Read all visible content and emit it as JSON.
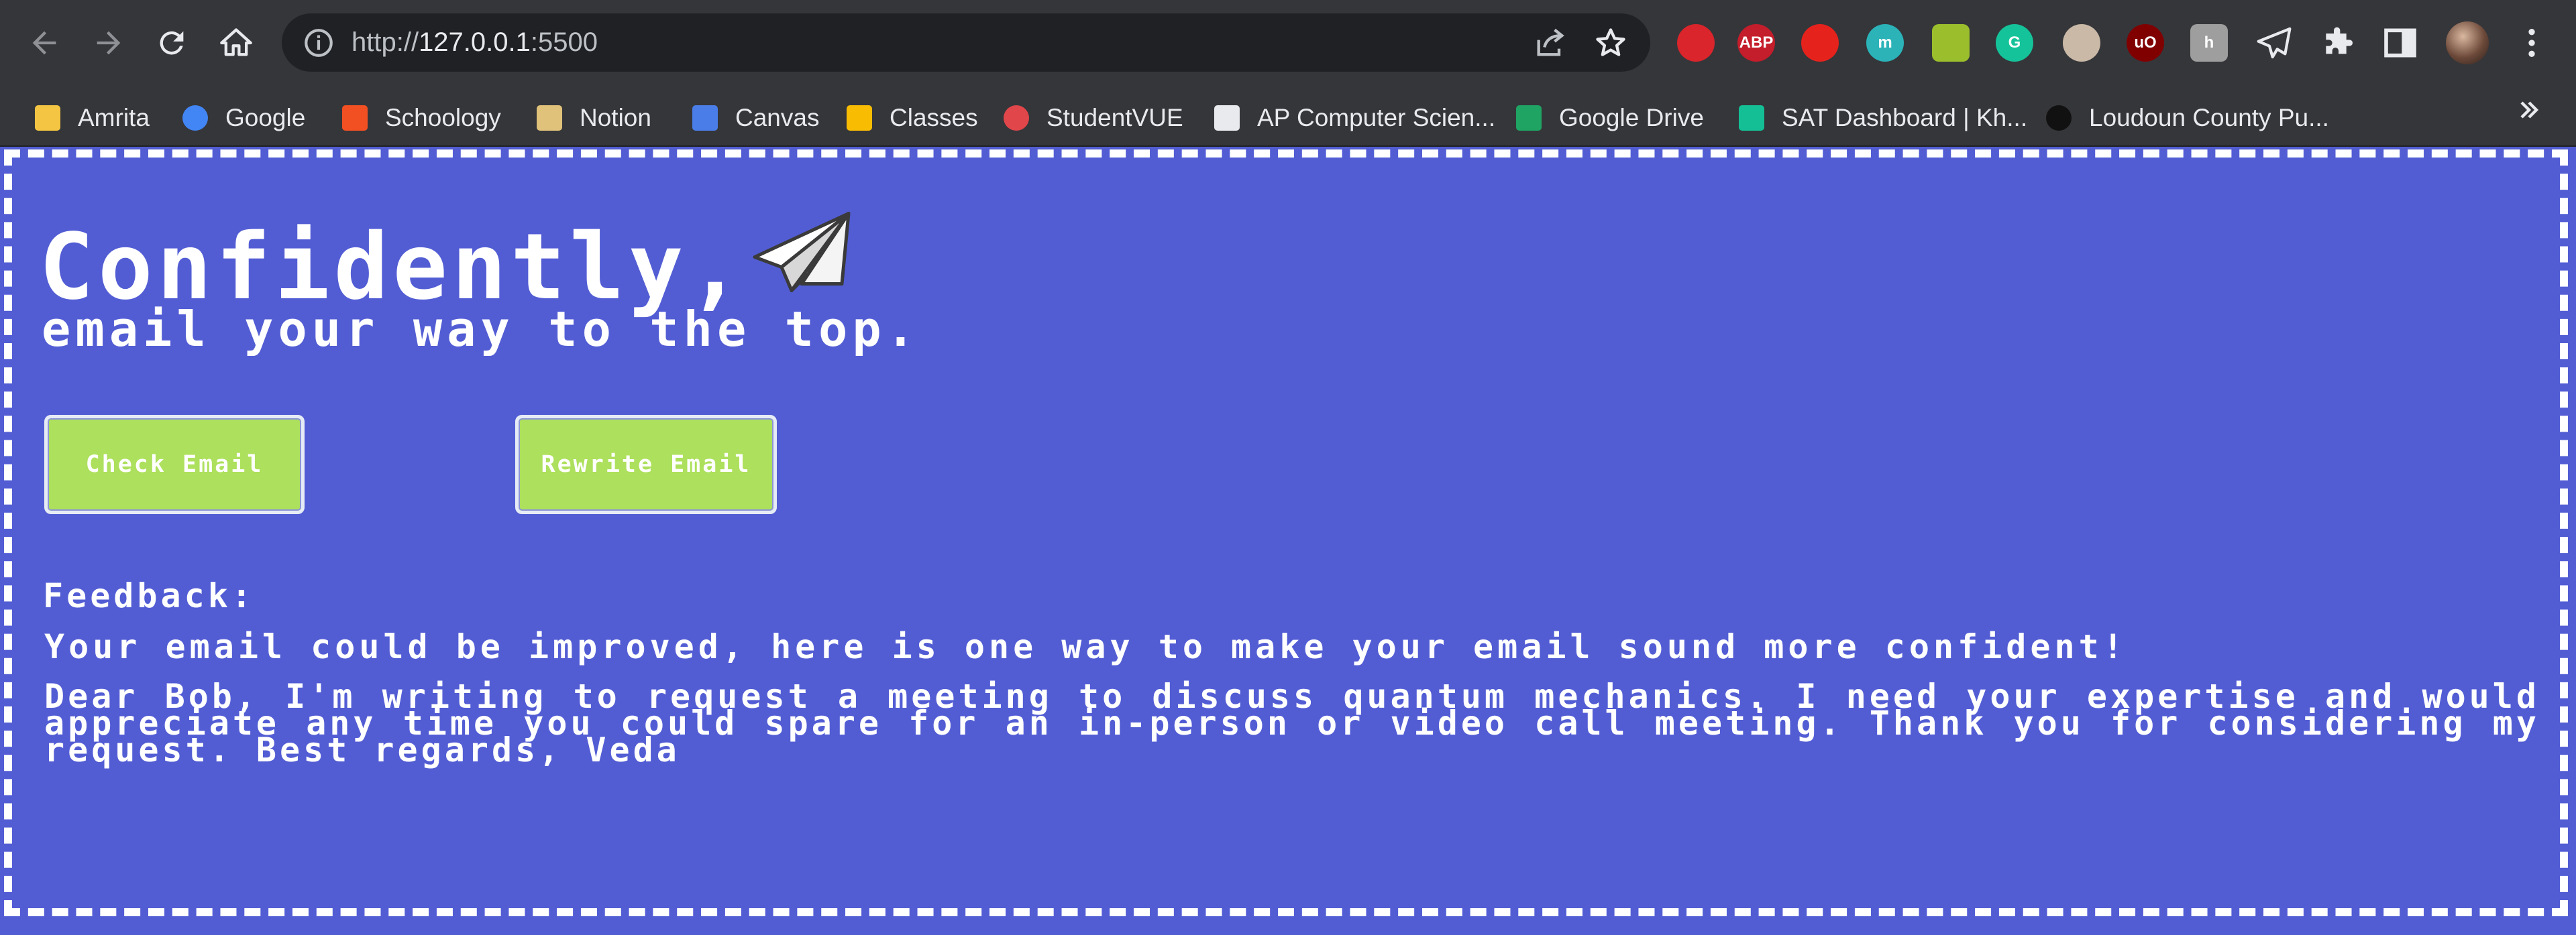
{
  "browser": {
    "url_scheme": "http://",
    "url_host": "127.0.0.1",
    "url_port": ":5500",
    "extensions": [
      {
        "name": "adblock-extension",
        "label": "",
        "color": "#d9252b"
      },
      {
        "name": "abp-extension",
        "label": "ABP",
        "color": "#c41d2b"
      },
      {
        "name": "video-speed-extension",
        "label": "",
        "color": "#e6221d"
      },
      {
        "name": "m-extension",
        "label": "m",
        "color": "#2bb3b8"
      },
      {
        "name": "earth-extension",
        "label": "",
        "color": "#9bbf2c"
      },
      {
        "name": "grammarly-extension",
        "label": "G",
        "color": "#15c39a"
      },
      {
        "name": "glasses-extension",
        "label": "",
        "color": "#c9b9a6"
      },
      {
        "name": "ublock-extension",
        "label": "uO",
        "color": "#800000"
      },
      {
        "name": "h-extension",
        "label": "h",
        "color": "#9e9e9e"
      }
    ]
  },
  "bookmarks": [
    {
      "label": "Amrita",
      "icon": "folder-icon",
      "color": "#f4c542"
    },
    {
      "label": "Google",
      "icon": "google-icon",
      "color": "#4285f4"
    },
    {
      "label": "Schoology",
      "icon": "schoology-icon",
      "color": "#f25022"
    },
    {
      "label": "Notion",
      "icon": "notion-icon",
      "color": "#e0c27a"
    },
    {
      "label": "Canvas",
      "icon": "canvas-icon",
      "color": "#4a7de8"
    },
    {
      "label": "Classes",
      "icon": "classroom-icon",
      "color": "#f8bc03"
    },
    {
      "label": "StudentVUE",
      "icon": "studentvue-icon",
      "color": "#e1464a"
    },
    {
      "label": "AP Computer Scien...",
      "icon": "blackboard-icon",
      "color": "#e8eaed"
    },
    {
      "label": "Google Drive",
      "icon": "drive-icon",
      "color": "#1fa463"
    },
    {
      "label": "SAT Dashboard | Kh...",
      "icon": "khan-icon",
      "color": "#14bf96"
    },
    {
      "label": "Loudoun County Pu...",
      "icon": "shield-icon",
      "color": "#111111"
    }
  ],
  "page": {
    "title": "Confidently,",
    "subtitle": "email your way to the top.",
    "check_button": "Check Email",
    "rewrite_button": "Rewrite Email",
    "feedback_label": "Feedback:",
    "feedback_summary": "Your email could be improved, here is one way to make your email sound more confident!",
    "feedback_email": "Dear Bob, I'm writing to request a meeting to discuss quantum mechanics. I need your expertise and would appreciate any time you could spare for an in-person or video call meeting. Thank you for considering my request. Best regards, Veda"
  },
  "colors": {
    "page_background": "#525dd4",
    "button_background": "#ade05c",
    "text": "#ffffff"
  }
}
